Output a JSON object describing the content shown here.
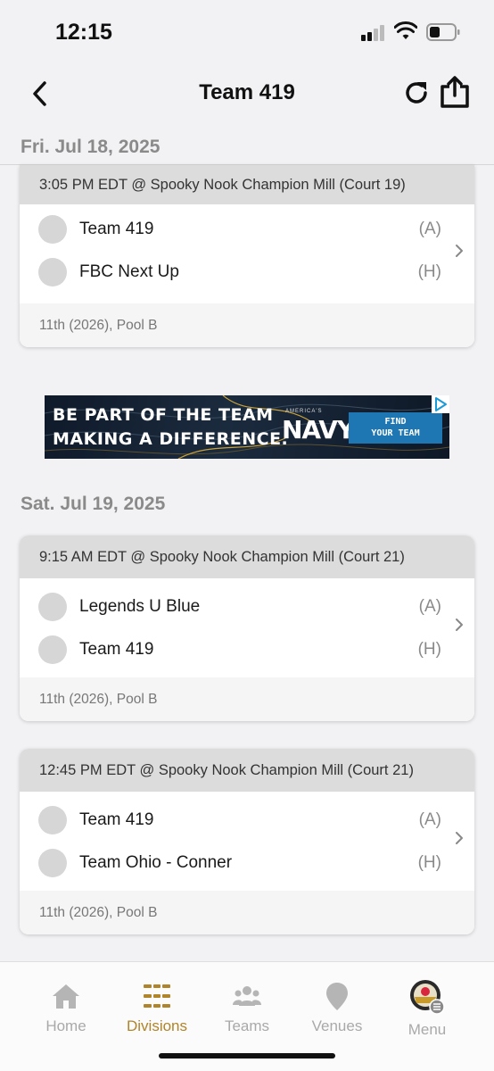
{
  "status_bar": {
    "time": "12:15"
  },
  "nav": {
    "title": "Team 419"
  },
  "days": [
    {
      "date": "Fri. Jul 18, 2025",
      "games": [
        {
          "header": "3:05 PM EDT @ Spooky Nook Champion Mill (Court 19)",
          "teams": [
            {
              "name": "Team 419",
              "side": "(A)"
            },
            {
              "name": "FBC Next Up",
              "side": "(H)"
            }
          ],
          "footer": "11th (2026), Pool B"
        }
      ]
    },
    {
      "date": "Sat. Jul 19, 2025",
      "games": [
        {
          "header": "9:15 AM EDT @ Spooky Nook Champion Mill (Court 21)",
          "teams": [
            {
              "name": "Legends U Blue",
              "side": "(A)"
            },
            {
              "name": "Team 419",
              "side": "(H)"
            }
          ],
          "footer": "11th (2026), Pool B"
        },
        {
          "header": "12:45 PM EDT @ Spooky Nook Champion Mill (Court 21)",
          "teams": [
            {
              "name": "Team 419",
              "side": "(A)"
            },
            {
              "name": "Team Ohio - Conner",
              "side": "(H)"
            }
          ],
          "footer": "11th (2026), Pool B"
        }
      ]
    }
  ],
  "ad": {
    "line1": "BE PART OF THE TEAM",
    "line2": "MAKING A DIFFERENCE.",
    "brand_small": "AMERICA'S",
    "brand": "NAVY",
    "cta_line1": "FIND",
    "cta_line2": "YOUR TEAM"
  },
  "tabs": [
    {
      "label": "Home",
      "icon": "home-icon"
    },
    {
      "label": "Divisions",
      "icon": "divisions-icon",
      "active": true
    },
    {
      "label": "Teams",
      "icon": "teams-icon"
    },
    {
      "label": "Venues",
      "icon": "location-pin-icon"
    },
    {
      "label": "Menu",
      "icon": "menu-logo-icon"
    }
  ],
  "colors": {
    "accent": "#b0842b",
    "inactive_tab": "#a9a9a9",
    "card_header": "#dcdcdc",
    "background": "#f2f2f4",
    "ad_cta": "#1e77b3"
  }
}
